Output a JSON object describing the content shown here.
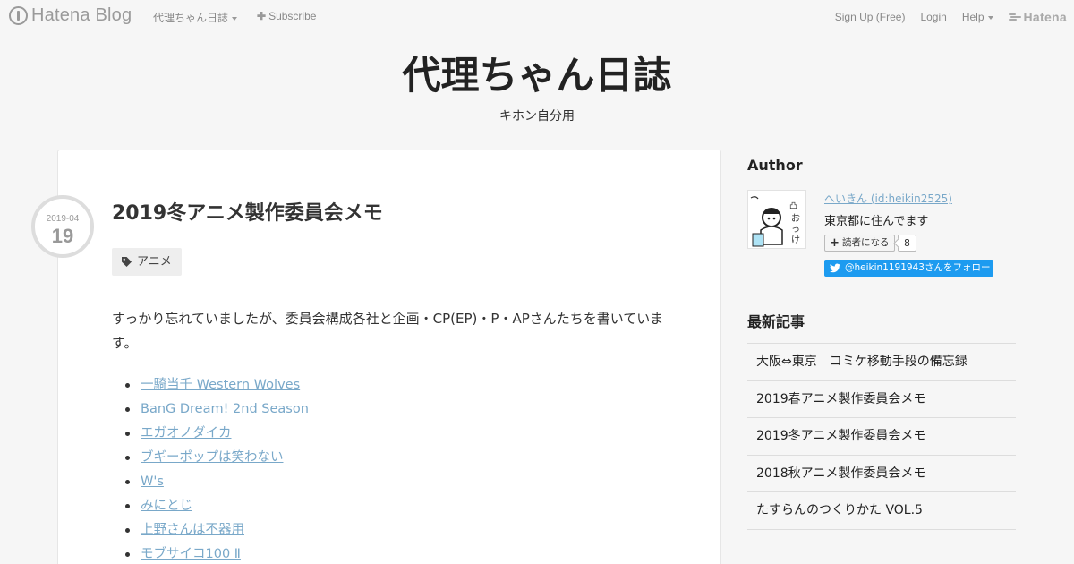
{
  "global_header": {
    "logo_text": "Hatena Blog",
    "blog_name": "代理ちゃん日誌",
    "subscribe_label": "Subscribe",
    "signup_label": "Sign Up (Free)",
    "login_label": "Login",
    "help_label": "Help",
    "hatena_label": "Hatena"
  },
  "blog": {
    "title": "代理ちゃん日誌",
    "description": "キホン自分用"
  },
  "entry": {
    "date_ym": "2019-04",
    "date_d": "19",
    "title": "2019冬アニメ製作委員会メモ",
    "category": "アニメ",
    "body_text": "すっかり忘れていましたが、委員会構成各社と企画・CP(EP)・P・APさんたちを書いています。",
    "list_items": [
      "一騎当千 Western Wolves",
      "BanG Dream! 2nd Season",
      "エガオノダイカ",
      "ブギーポップは笑わない",
      "W's",
      "みにとじ",
      "上野さんは不器用",
      "モブサイコ100 Ⅱ"
    ]
  },
  "sidebar": {
    "author_heading": "Author",
    "author_id": "へいきん (id:heikin2525)",
    "author_desc": "東京都に住んでます",
    "reader_button_label": "読者になる",
    "reader_count": "8",
    "twitter_label": "@heikin1191943さんをフォロー",
    "recent_heading": "最新記事",
    "recent_items": [
      "大阪⇔東京　コミケ移動手段の備忘録",
      "2019春アニメ製作委員会メモ",
      "2019冬アニメ製作委員会メモ",
      "2018秋アニメ製作委員会メモ",
      "たすらんのつくりかた VOL.5"
    ]
  }
}
